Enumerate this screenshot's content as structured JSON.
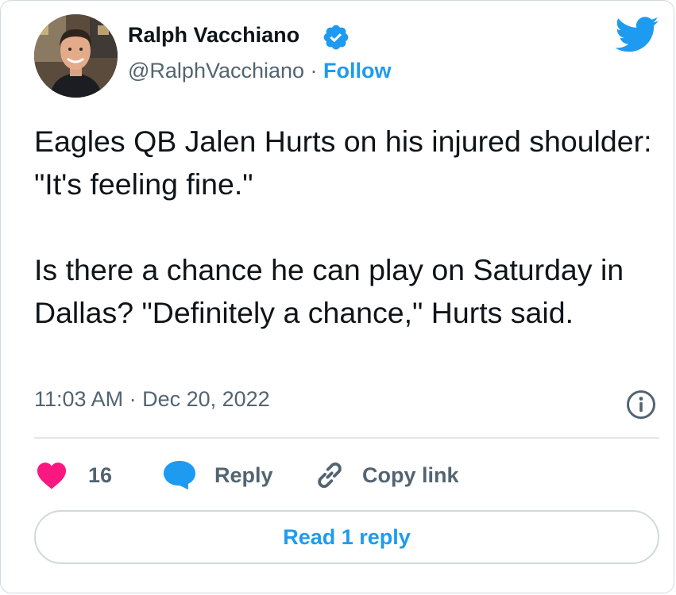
{
  "author": {
    "display_name": "Ralph Vacchiano",
    "handle": "@RalphVacchiano",
    "separator": " · ",
    "follow_label": "Follow"
  },
  "tweet": {
    "text": "Eagles QB Jalen Hurts on his injured shoulder: \"It's feeling fine.\"\n\nIs there a chance he can play on Saturday in Dallas? \"Definitely a chance,\" Hurts said.",
    "timestamp": "11:03 AM · Dec 20, 2022"
  },
  "actions": {
    "like_count": "16",
    "reply_label": "Reply",
    "copy_link_label": "Copy link"
  },
  "read_replies_label": "Read 1 reply",
  "icons": {
    "brand": "twitter-bird-icon",
    "verified": "verified-badge-icon",
    "info": "info-icon",
    "like": "heart-icon",
    "reply": "speech-bubble-icon",
    "copy": "link-icon"
  },
  "colors": {
    "accent": "#1d9bf0",
    "like": "#f91880",
    "text": "#0f1419",
    "secondary": "#536471",
    "border": "#cfd9de"
  }
}
